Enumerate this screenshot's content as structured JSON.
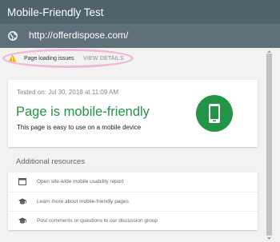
{
  "header": {
    "title": "Mobile-Friendly Test",
    "url": "http://offerdispose.com/",
    "globe_icon": "globe-icon"
  },
  "warning": {
    "icon": "warning-icon",
    "text": "Page loading issues",
    "action_label": "VIEW DETAILS",
    "icon_color": "#f4b400",
    "highlight_color": "#f1b8d8"
  },
  "result": {
    "tested_on": "Tested on: Jul 30, 2018 at 11:09 AM",
    "title": "Page is mobile-friendly",
    "description": "This page is easy to use on a mobile device",
    "icon": "mobile-phone-icon",
    "accent_color": "#239446"
  },
  "resources": {
    "title": "Additional resources",
    "items": [
      {
        "label": "Open site-wide mobile usability report",
        "icon": "report-icon"
      },
      {
        "label": "Learn more about mobile-friendly pages",
        "icon": "graduation-cap-icon"
      },
      {
        "label": "Post comments or questions to our discussion group",
        "icon": "graduation-cap-icon"
      }
    ]
  },
  "colors": {
    "header_bg": "#4f636b",
    "urlbar_bg": "#5f7078",
    "page_bg": "#f2f2f2"
  }
}
